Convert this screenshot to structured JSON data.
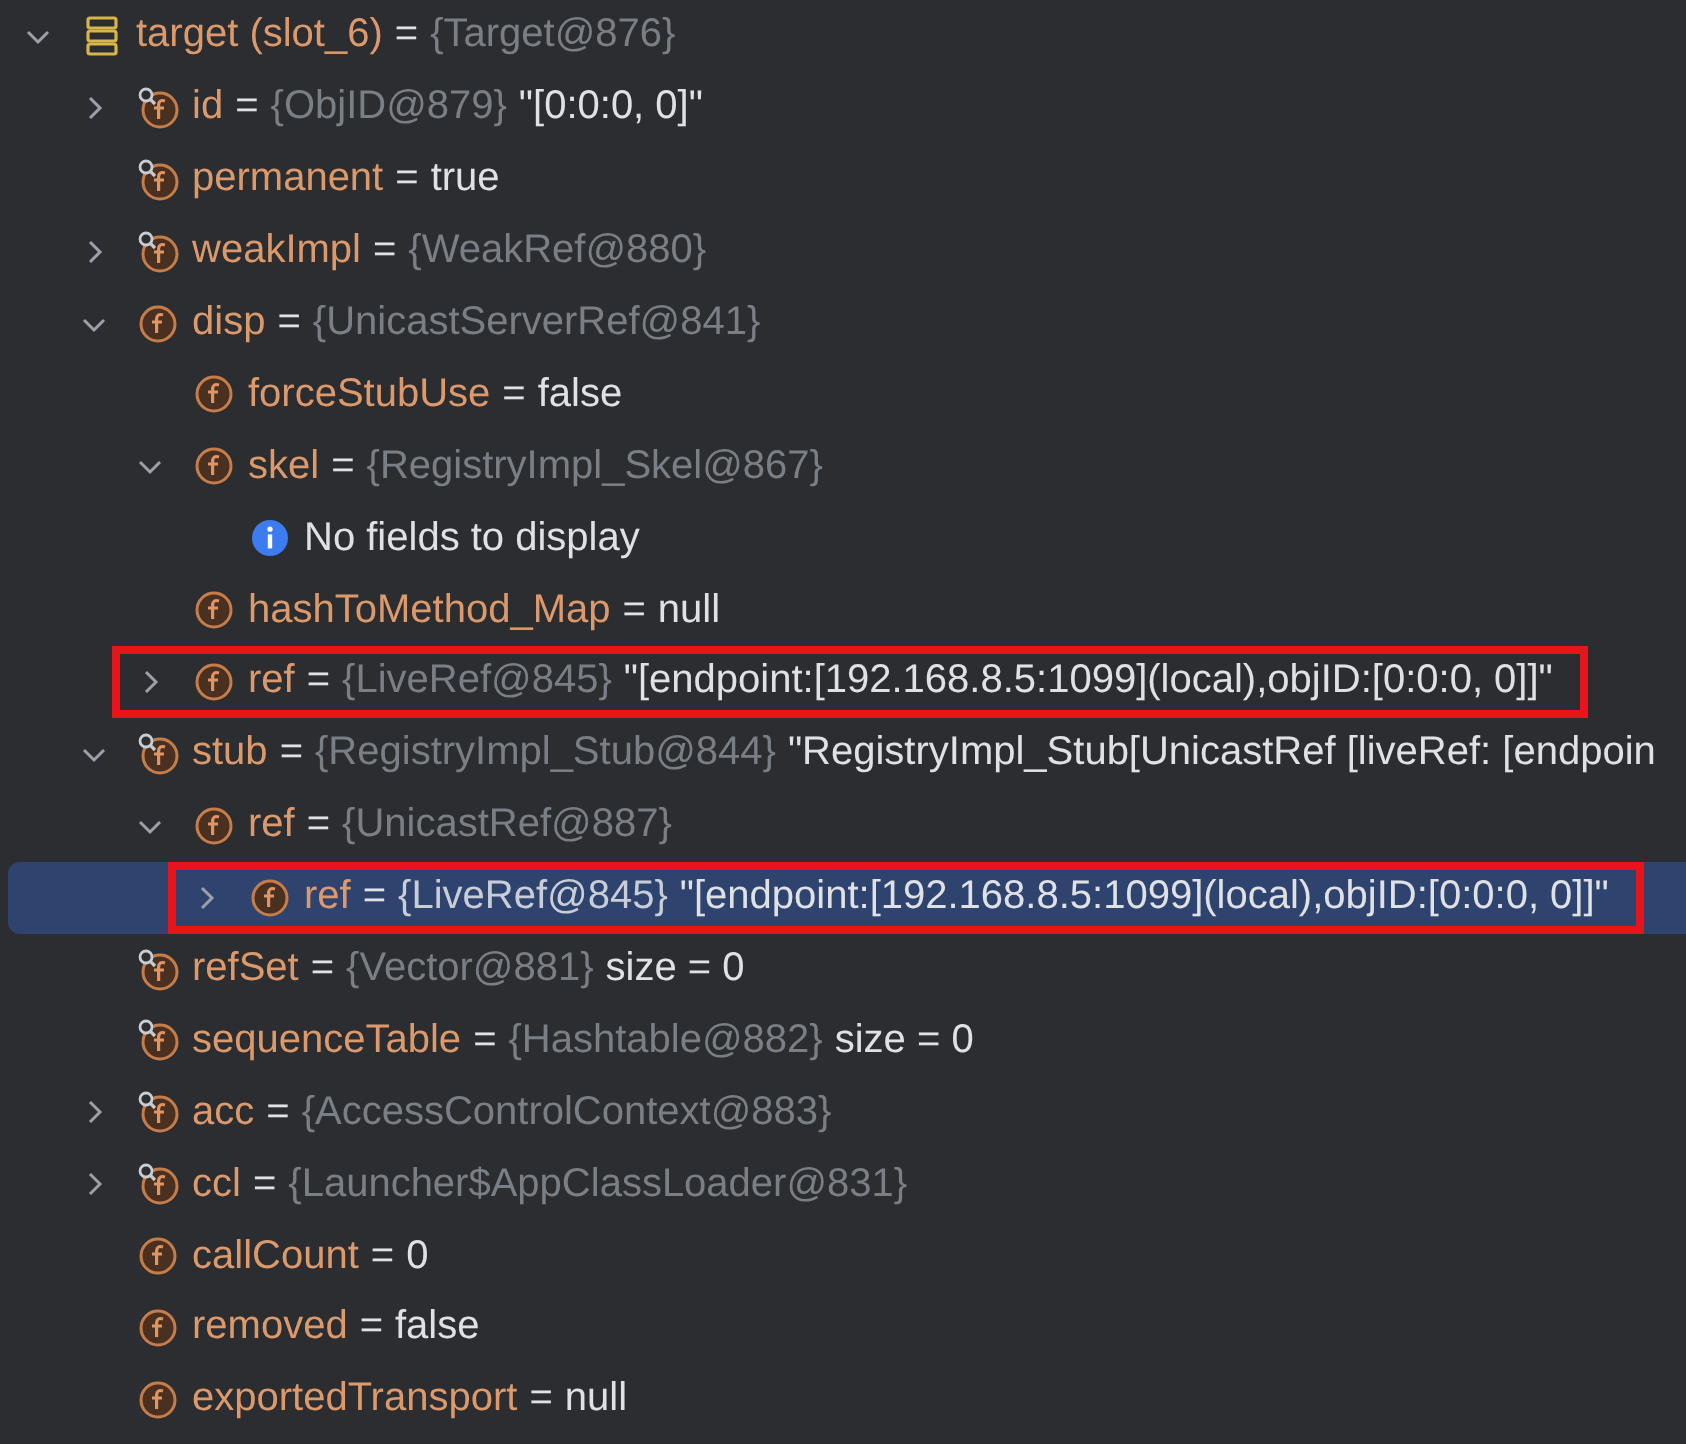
{
  "variables": [
    {
      "kind": "local",
      "name": "target (slot_6)",
      "operator": "=",
      "type": "{Target@876}",
      "expanded": true,
      "selected": false,
      "boxed": false,
      "children": [
        {
          "kind": "watched",
          "name": "id",
          "operator": "=",
          "type": "{ObjID@879}",
          "value": "\"[0:0:0, 0]\"",
          "expanded": false,
          "selected": false,
          "boxed": false
        },
        {
          "kind": "watched",
          "name": "permanent",
          "operator": "=",
          "value": "true",
          "selected": false,
          "boxed": false
        },
        {
          "kind": "watched",
          "name": "weakImpl",
          "operator": "=",
          "type": "{WeakRef@880}",
          "expanded": false,
          "selected": false,
          "boxed": false
        },
        {
          "kind": "field",
          "name": "disp",
          "operator": "=",
          "type": "{UnicastServerRef@841}",
          "expanded": true,
          "selected": false,
          "boxed": false,
          "children": [
            {
              "kind": "field",
              "name": "forceStubUse",
              "operator": "=",
              "value": "false",
              "selected": false,
              "boxed": false
            },
            {
              "kind": "field",
              "name": "skel",
              "operator": "=",
              "type": "{RegistryImpl_Skel@867}",
              "expanded": true,
              "selected": false,
              "boxed": false,
              "children": [
                {
                  "kind": "message",
                  "name": "No fields to display",
                  "selected": false,
                  "boxed": false
                }
              ]
            },
            {
              "kind": "field",
              "name": "hashToMethod_Map",
              "operator": "=",
              "value": "null",
              "selected": false,
              "boxed": false
            },
            {
              "kind": "field",
              "name": "ref",
              "operator": "=",
              "type": "{LiveRef@845}",
              "value": "\"[endpoint:[192.168.8.5:1099](local),objID:[0:0:0, 0]]\"",
              "expanded": false,
              "selected": false,
              "boxed": true
            }
          ]
        },
        {
          "kind": "watched",
          "name": "stub",
          "operator": "=",
          "type": "{RegistryImpl_Stub@844}",
          "value": "\"RegistryImpl_Stub[UnicastRef [liveRef: [endpoin",
          "expanded": true,
          "selected": false,
          "boxed": false,
          "children": [
            {
              "kind": "field",
              "name": "ref",
              "operator": "=",
              "type": "{UnicastRef@887}",
              "expanded": true,
              "selected": false,
              "boxed": false,
              "children": [
                {
                  "kind": "field",
                  "name": "ref",
                  "operator": "=",
                  "type": "{LiveRef@845}",
                  "value": "\"[endpoint:[192.168.8.5:1099](local),objID:[0:0:0, 0]]\"",
                  "expanded": false,
                  "selected": true,
                  "boxed": true
                }
              ]
            }
          ]
        },
        {
          "kind": "watched",
          "name": "refSet",
          "operator": "=",
          "type": "{Vector@881}",
          "value": "size = 0",
          "selected": false,
          "boxed": false
        },
        {
          "kind": "watched",
          "name": "sequenceTable",
          "operator": "=",
          "type": "{Hashtable@882}",
          "value": "size = 0",
          "selected": false,
          "boxed": false
        },
        {
          "kind": "watched",
          "name": "acc",
          "operator": "=",
          "type": "{AccessControlContext@883}",
          "expanded": false,
          "selected": false,
          "boxed": false
        },
        {
          "kind": "watched",
          "name": "ccl",
          "operator": "=",
          "type": "{Launcher$AppClassLoader@831}",
          "expanded": false,
          "selected": false,
          "boxed": false
        },
        {
          "kind": "field",
          "name": "callCount",
          "operator": "=",
          "value": "0",
          "selected": false,
          "boxed": false
        },
        {
          "kind": "field",
          "name": "removed",
          "operator": "=",
          "value": "false",
          "selected": false,
          "boxed": false
        },
        {
          "kind": "field",
          "name": "exportedTransport",
          "operator": "=",
          "value": "null",
          "selected": false,
          "boxed": false
        }
      ]
    }
  ]
}
